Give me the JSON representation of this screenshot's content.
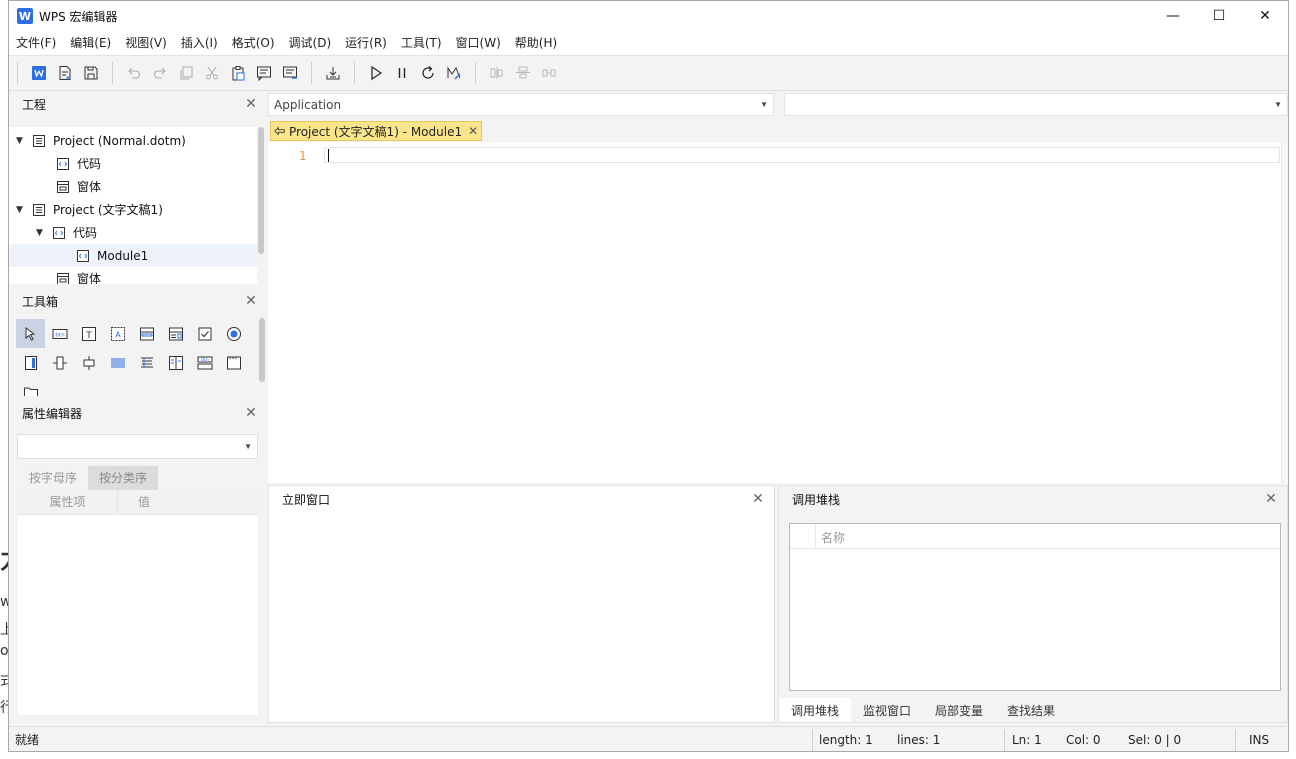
{
  "window": {
    "title": "WPS 宏编辑器",
    "minimize": "—",
    "maximize": "☐",
    "close": "✕"
  },
  "background_fragments": [
    "力",
    "w",
    "上",
    "oc",
    "式",
    "行"
  ],
  "menu": [
    "文件(F)",
    "编辑(E)",
    "视图(V)",
    "插入(I)",
    "格式(O)",
    "调试(D)",
    "运行(R)",
    "工具(T)",
    "窗口(W)",
    "帮助(H)"
  ],
  "project_panel": {
    "title": "工程",
    "tree": [
      {
        "label": "Project (Normal.dotm)",
        "expanded": true,
        "level": 0
      },
      {
        "label": "代码",
        "level": 1
      },
      {
        "label": "窗体",
        "level": 1
      },
      {
        "label": "Project (文字文稿1)",
        "expanded": true,
        "level": 0
      },
      {
        "label": "代码",
        "expanded": true,
        "level": 1
      },
      {
        "label": "Module1",
        "level": 2,
        "selected": true
      },
      {
        "label": "窗体",
        "level": 1
      }
    ]
  },
  "toolbox_panel": {
    "title": "工具箱"
  },
  "property_panel": {
    "title": "属性编辑器",
    "tabs": [
      "按字母序",
      "按分类序"
    ],
    "columns": [
      "属性项",
      "值"
    ]
  },
  "editor": {
    "object_combo": "Application",
    "proc_combo": "",
    "tab_label": "Project (文字文稿1) - Module1",
    "line_number": "1"
  },
  "immediate_panel": {
    "title": "立即窗口"
  },
  "callstack_panel": {
    "title": "调用堆栈",
    "column": "名称",
    "tabs": [
      "调用堆栈",
      "监视窗口",
      "局部变量",
      "查找结果"
    ]
  },
  "status": {
    "state": "就绪",
    "length": "length: 1",
    "lines": "lines: 1",
    "ln": "Ln: 1",
    "col": "Col: 0",
    "sel": "Sel: 0 | 0",
    "mode": "INS"
  },
  "colors": {
    "accent": "#2f6fe4",
    "tab_highlight": "#fbe58a",
    "line_number": "#e8903a"
  }
}
